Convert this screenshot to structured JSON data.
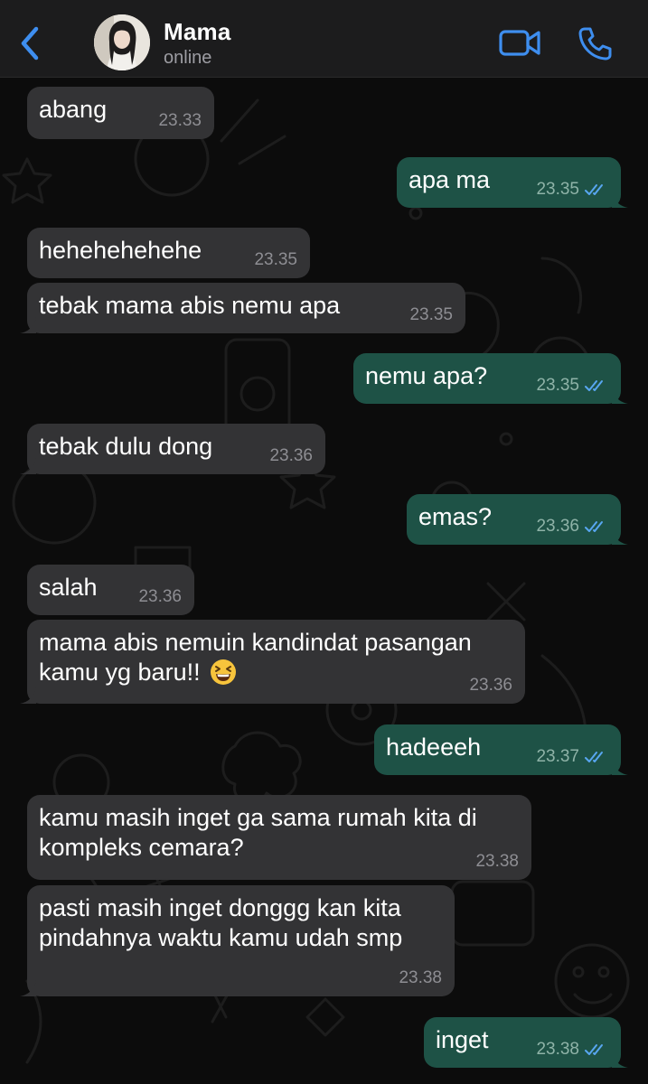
{
  "header": {
    "contact_name": "Mama",
    "status": "online",
    "back_icon": "chevron-left-icon",
    "video_icon": "video-camera-icon",
    "call_icon": "phone-icon"
  },
  "colors": {
    "accent": "#3e8eef",
    "incoming_bubble": "#333335",
    "outgoing_bubble": "#1e5246",
    "read_ticks": "#58a6f0"
  },
  "messages": [
    {
      "side": "in",
      "text": "abang",
      "time": "23.33"
    },
    {
      "side": "out",
      "text": "apa ma",
      "time": "23.35",
      "read": true
    },
    {
      "side": "in",
      "text": "hehehehehehe",
      "time": "23.35"
    },
    {
      "side": "in",
      "text": "tebak mama abis nemu apa",
      "time": "23.35"
    },
    {
      "side": "out",
      "text": "nemu apa?",
      "time": "23.35",
      "read": true
    },
    {
      "side": "in",
      "text": "tebak dulu dong",
      "time": "23.36"
    },
    {
      "side": "out",
      "text": "emas?",
      "time": "23.36",
      "read": true
    },
    {
      "side": "in",
      "text": "salah",
      "time": "23.36"
    },
    {
      "side": "in",
      "lines": [
        "mama abis nemuin kandindat pasangan",
        "kamu yg baru!!"
      ],
      "emoji": "grinning-squinting-face",
      "time": "23.36"
    },
    {
      "side": "out",
      "text": "hadeeeh",
      "time": "23.37",
      "read": true
    },
    {
      "side": "in",
      "lines": [
        "kamu masih inget ga sama rumah kita di",
        "kompleks cemara?"
      ],
      "time": "23.38"
    },
    {
      "side": "in",
      "lines": [
        "pasti masih inget donggg kan kita",
        "pindahnya waktu kamu udah smp"
      ],
      "time": "23.38"
    },
    {
      "side": "out",
      "text": "inget",
      "time": "23.38",
      "read": true
    }
  ]
}
